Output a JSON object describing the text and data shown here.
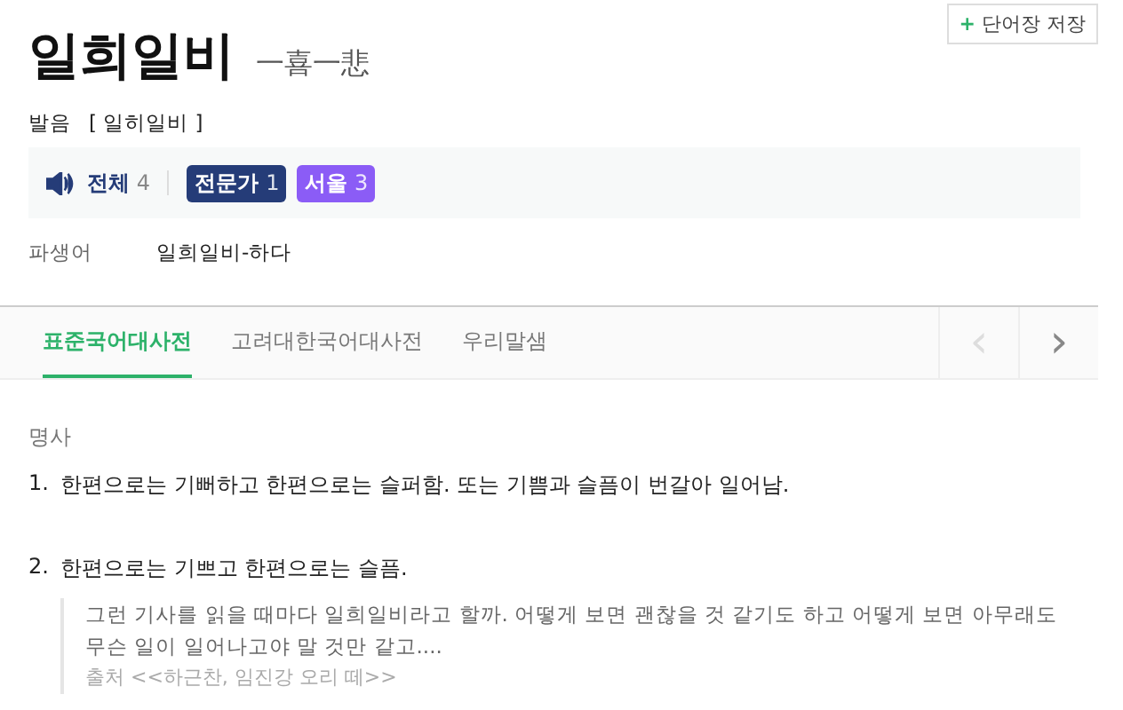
{
  "save_button": {
    "icon": "+",
    "label": "단어장 저장"
  },
  "headword": {
    "word": "일희일비",
    "hanja": "一喜一悲"
  },
  "pronunciation": {
    "label": "발음",
    "value": "[ 일히일비 ]"
  },
  "audio": {
    "label": "전체",
    "count": "4",
    "badges": [
      {
        "label": "전문가",
        "count": "1",
        "color": "#253c78"
      },
      {
        "label": "서울",
        "count": "3",
        "color": "#8b5cf6"
      }
    ]
  },
  "derivative": {
    "label": "파생어",
    "value": "일희일비-하다"
  },
  "tabs": [
    {
      "label": "표준국어대사전",
      "selected": true
    },
    {
      "label": "고려대한국어대사전",
      "selected": false
    },
    {
      "label": "우리말샘",
      "selected": false
    }
  ],
  "nav": [
    {
      "icon": "‹",
      "disabled": true
    },
    {
      "icon": "›",
      "disabled": false
    }
  ],
  "part_of_speech": "명사",
  "definitions": [
    {
      "number": "1.",
      "text": "한편으로는 기뻐하고 한편으로는 슬퍼함. 또는 기쁨과 슬픔이 번갈아 일어남."
    },
    {
      "number": "2.",
      "text": "한편으로는 기쁘고 한편으로는 슬픔.",
      "example": "그런 기사를 읽을 때마다 일희일비라고 할까. 어떻게 보면 괜찮을 것 같기도 하고 어떻게 보면 아무래도 무슨 일이 일어나고야 말 것만 같고....",
      "source": "출처 <<하근찬, 임진강 오리 떼>>"
    }
  ]
}
